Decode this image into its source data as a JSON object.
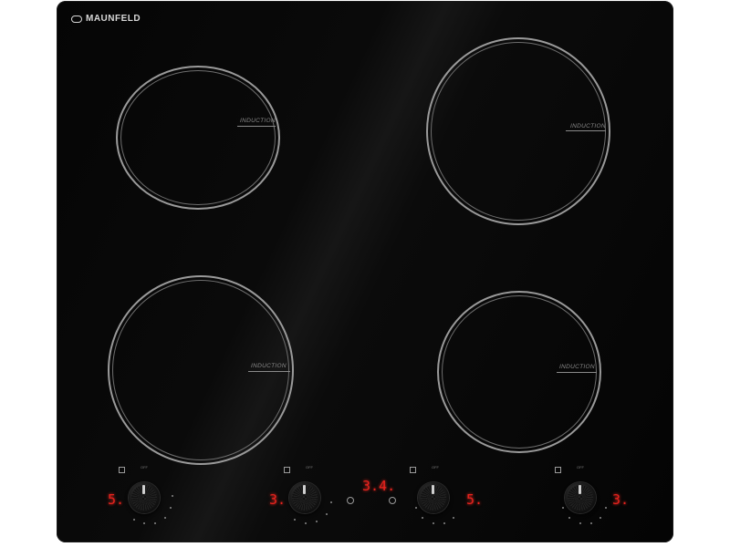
{
  "brand": {
    "name": "MAUNFELD"
  },
  "zones": [
    {
      "label": "INDUCTION"
    },
    {
      "label": "INDUCTION"
    },
    {
      "label": "INDUCTION"
    },
    {
      "label": "INDUCTION"
    }
  ],
  "controls": {
    "displays": [
      "5.",
      "3.",
      "5.",
      "3."
    ],
    "timer_display": "3.4.",
    "knob_off_label": "OFF"
  },
  "colors": {
    "glass": "#050505",
    "ring": "#9a9a9a",
    "display_red": "#e8231e"
  }
}
